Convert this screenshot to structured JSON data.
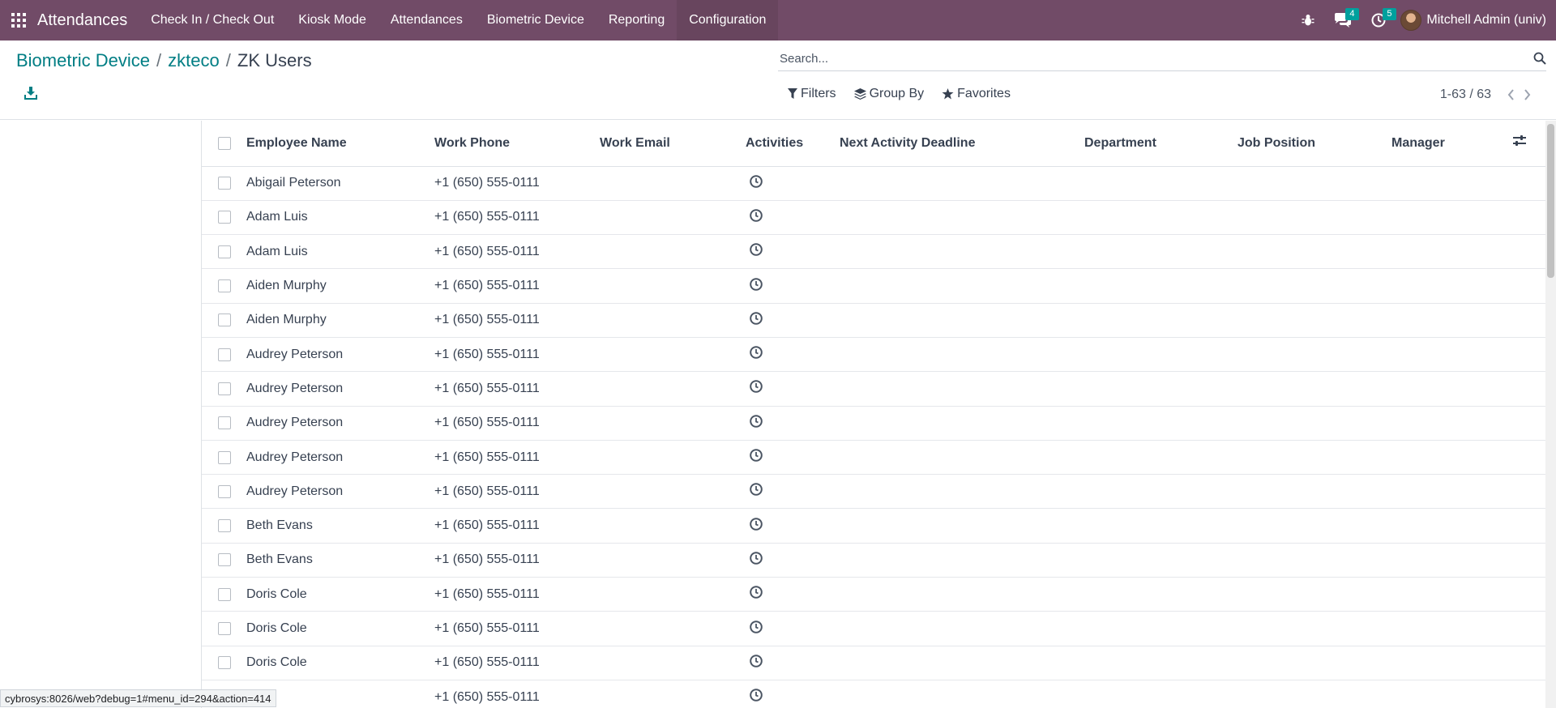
{
  "navbar": {
    "app_name": "Attendances",
    "menu": [
      "Check In / Check Out",
      "Kiosk Mode",
      "Attendances",
      "Biometric Device",
      "Reporting",
      "Configuration"
    ],
    "active_menu": "Configuration",
    "messages_count": "4",
    "activities_count": "5",
    "user_name": "Mitchell Admin (univ)",
    "color": "#714b67"
  },
  "breadcrumb": {
    "items": [
      "Biometric Device",
      "zkteco"
    ],
    "current": "ZK Users"
  },
  "search": {
    "placeholder": "Search..."
  },
  "search_panel": {
    "filters_label": "Filters",
    "group_by_label": "Group By",
    "favorites_label": "Favorites"
  },
  "pager": {
    "value": "1-63 / 63"
  },
  "table": {
    "columns": [
      "Employee Name",
      "Work Phone",
      "Work Email",
      "Activities",
      "Next Activity Deadline",
      "Department",
      "Job Position",
      "Manager"
    ],
    "rows": [
      {
        "name": "Abigail Peterson",
        "phone": "+1 (650) 555-0111"
      },
      {
        "name": "Adam Luis",
        "phone": "+1 (650) 555-0111"
      },
      {
        "name": "Adam Luis",
        "phone": "+1 (650) 555-0111"
      },
      {
        "name": "Aiden Murphy",
        "phone": "+1 (650) 555-0111"
      },
      {
        "name": "Aiden Murphy",
        "phone": "+1 (650) 555-0111"
      },
      {
        "name": "Audrey Peterson",
        "phone": "+1 (650) 555-0111"
      },
      {
        "name": "Audrey Peterson",
        "phone": "+1 (650) 555-0111"
      },
      {
        "name": "Audrey Peterson",
        "phone": "+1 (650) 555-0111"
      },
      {
        "name": "Audrey Peterson",
        "phone": "+1 (650) 555-0111"
      },
      {
        "name": "Audrey Peterson",
        "phone": "+1 (650) 555-0111"
      },
      {
        "name": "Beth Evans",
        "phone": "+1 (650) 555-0111"
      },
      {
        "name": "Beth Evans",
        "phone": "+1 (650) 555-0111"
      },
      {
        "name": "Doris Cole",
        "phone": "+1 (650) 555-0111"
      },
      {
        "name": "Doris Cole",
        "phone": "+1 (650) 555-0111"
      },
      {
        "name": "Doris Cole",
        "phone": "+1 (650) 555-0111"
      },
      {
        "name": "",
        "phone": "+1 (650) 555-0111"
      }
    ]
  },
  "status_bar": {
    "url": "cybrosys:8026/web?debug=1#menu_id=294&action=414"
  }
}
